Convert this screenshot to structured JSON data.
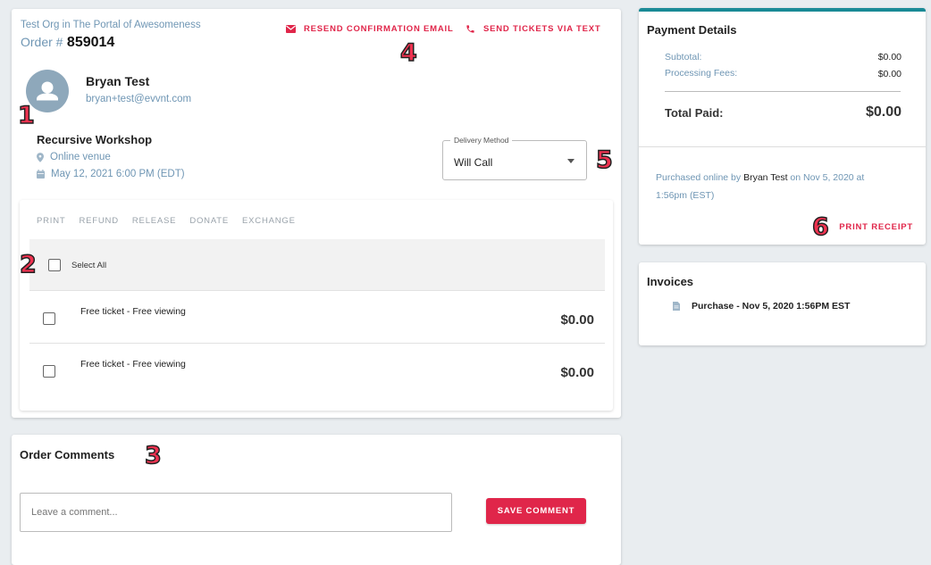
{
  "order": {
    "org_line": "Test Org in The Portal of Awesomeness",
    "order_label": "Order #",
    "order_number": "859014",
    "actions": {
      "resend_email": "RESEND CONFIRMATION EMAIL",
      "send_text": "SEND TICKETS VIA TEXT"
    },
    "customer": {
      "name": "Bryan Test",
      "email": "bryan+test@evvnt.com"
    },
    "event": {
      "title": "Recursive Workshop",
      "venue": "Online venue",
      "date": "May 12, 2021 6:00 PM (EDT)"
    },
    "delivery": {
      "label": "Delivery Method",
      "value": "Will Call"
    },
    "ticket_actions": [
      "PRINT",
      "REFUND",
      "RELEASE",
      "DONATE",
      "EXCHANGE"
    ],
    "select_all": "Select All",
    "tickets": [
      {
        "name": "Free ticket - Free viewing",
        "price": "$0.00"
      },
      {
        "name": "Free ticket - Free viewing",
        "price": "$0.00"
      }
    ]
  },
  "comments": {
    "title": "Order Comments",
    "placeholder": "Leave a comment...",
    "save_button": "SAVE COMMENT"
  },
  "payment": {
    "title": "Payment Details",
    "subtotal_label": "Subtotal:",
    "subtotal_value": "$0.00",
    "fees_label": "Processing Fees:",
    "fees_value": "$0.00",
    "total_label": "Total Paid:",
    "total_value": "$0.00",
    "purchased_prefix": "Purchased online by",
    "purchased_name": "Bryan Test",
    "purchased_suffix": "on Nov 5, 2020 at",
    "purchased_time": "1:56pm (EST)",
    "print_receipt": "PRINT RECEIPT"
  },
  "invoices": {
    "title": "Invoices",
    "items": [
      "Purchase - Nov 5, 2020 1:56PM EST"
    ]
  },
  "annotations": [
    "1",
    "2",
    "3",
    "4",
    "5",
    "6"
  ],
  "colors": {
    "accent": "#e0264a",
    "link": "#6f96b4",
    "teal": "#1a8a96"
  }
}
